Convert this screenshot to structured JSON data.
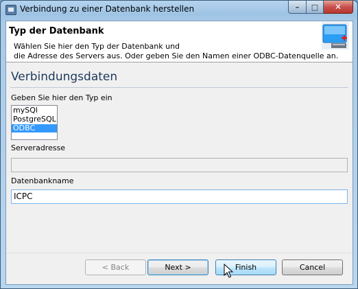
{
  "window": {
    "title": "Verbindung zu einer Datenbank herstellen"
  },
  "header": {
    "title": "Typ der Datenbank",
    "description": "Wählen Sie hier den Typ der Datenbank und\ndie Adresse des Servers aus. Oder geben Sie den Namen einer ODBC-Datenquelle an."
  },
  "section": {
    "title": "Verbindungsdaten"
  },
  "type_field": {
    "label": "Geben Sie hier den Typ ein",
    "options": [
      "mySQl",
      "PostgreSQL",
      "ODBC"
    ],
    "selected": "ODBC"
  },
  "server_field": {
    "label": "Serveradresse",
    "value": ""
  },
  "dbname_field": {
    "label": "Datenbankname",
    "value": "ICPC"
  },
  "buttons": {
    "back": "< Back",
    "next": "Next >",
    "finish": "Finish",
    "cancel": "Cancel"
  },
  "icons": {
    "app": "window-icon",
    "header": "database-add-icon",
    "cursor": "mouse-pointer-icon"
  },
  "colors": {
    "selection": "#3399ff",
    "section_title": "#1e395b",
    "close_button": "#c75050"
  }
}
